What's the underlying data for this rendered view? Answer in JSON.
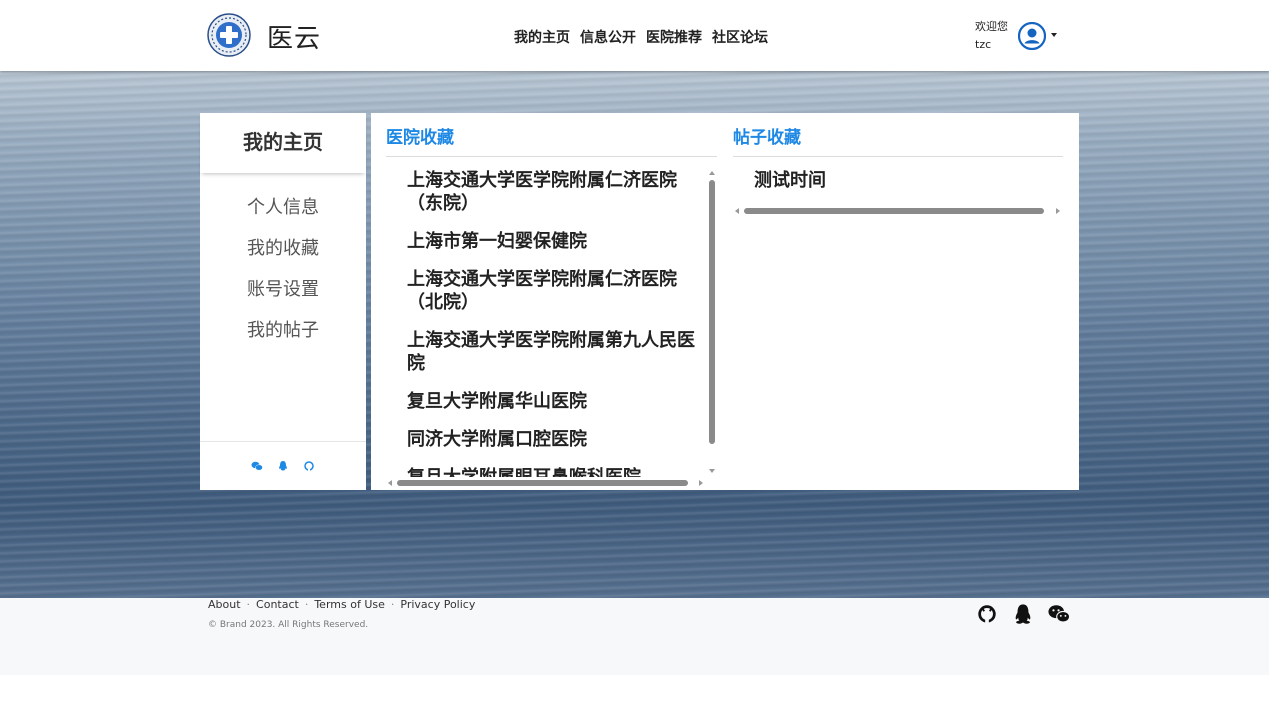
{
  "header": {
    "brand": "医云",
    "nav": [
      "我的主页",
      "信息公开",
      "医院推荐",
      "社区论坛"
    ],
    "welcome": "欢迎您",
    "username": "tzc"
  },
  "sidebar": {
    "title": "我的主页",
    "items": [
      "个人信息",
      "我的收藏",
      "账号设置",
      "我的帖子"
    ],
    "footer_icons": [
      "wechat-icon",
      "qq-icon",
      "github-icon"
    ]
  },
  "main": {
    "hospital_title": "医院收藏",
    "hospitals": [
      "上海交通大学医学院附属仁济医院（东院）",
      "上海市第一妇婴保健院",
      "上海交通大学医学院附属仁济医院（北院）",
      "上海交通大学医学院附属第九人民医院",
      "复旦大学附属华山医院",
      "同济大学附属口腔医院",
      "复旦大学附属眼耳鼻喉科医院"
    ],
    "post_title": "帖子收藏",
    "posts": [
      "测试时间"
    ]
  },
  "footer": {
    "links": [
      "About",
      "Contact",
      "Terms of Use",
      "Privacy Policy"
    ],
    "copyright": "© Brand 2023. All Rights Reserved.",
    "icons": [
      "github-icon",
      "qq-icon",
      "wechat-icon"
    ]
  },
  "colors": {
    "accent": "#1e88e5",
    "avatar": "#1565c0"
  }
}
